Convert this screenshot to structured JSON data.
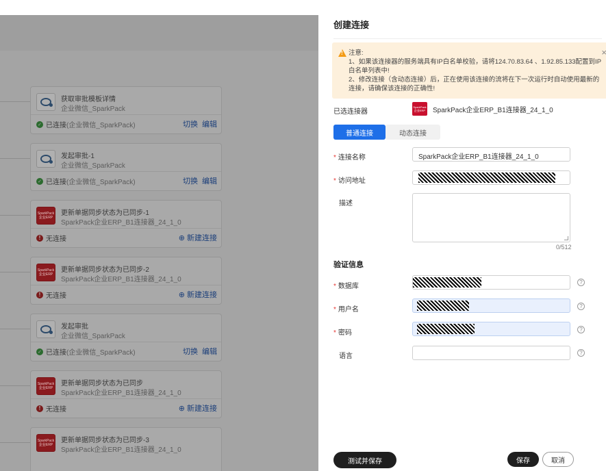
{
  "flow": {
    "cards": [
      {
        "title": "获取审批模板详情",
        "subtitle": "企业微信_SparkPack",
        "icon": "wecom-chat-icon",
        "status_text": "已连接",
        "status_detail": "(企业微信_SparkPack)",
        "connected": true,
        "action1": "切换",
        "action2": "编辑"
      },
      {
        "title": "发起审批-1",
        "subtitle": "企业微信_SparkPack",
        "icon": "wecom-chat-icon",
        "status_text": "已连接",
        "status_detail": "(企业微信_SparkPack)",
        "connected": true,
        "action1": "切换",
        "action2": "编辑"
      },
      {
        "title": "更新单据同步状态为已同步-1",
        "subtitle": "SparkPack企业ERP_B1连接器_24_1_0",
        "icon": "sparkpack-logo-icon",
        "status_text": "无连接",
        "connected": false,
        "action_new": "⊕ 新建连接"
      },
      {
        "title": "更新单据同步状态为已同步-2",
        "subtitle": "SparkPack企业ERP_B1连接器_24_1_0",
        "icon": "sparkpack-logo-icon",
        "status_text": "无连接",
        "connected": false,
        "action_new": "⊕ 新建连接"
      },
      {
        "title": "发起审批",
        "subtitle": "企业微信_SparkPack",
        "icon": "wecom-chat-icon",
        "status_text": "已连接",
        "status_detail": "(企业微信_SparkPack)",
        "connected": true,
        "action1": "切换",
        "action2": "编辑"
      },
      {
        "title": "更新单据同步状态为已同步",
        "subtitle": "SparkPack企业ERP_B1连接器_24_1_0",
        "icon": "sparkpack-logo-icon",
        "status_text": "无连接",
        "connected": false,
        "action_new": "⊕ 新建连接"
      },
      {
        "title": "更新单据同步状态为已同步-3",
        "subtitle": "SparkPack企业ERP_B1连接器_24_1_0",
        "icon": "sparkpack-logo-icon"
      }
    ],
    "logo_text_line1": "SparkPack",
    "logo_text_line2": "企业ERP"
  },
  "drawer": {
    "title": "创建连接",
    "notice": {
      "heading": "注意:",
      "line1": "1、如果该连接器的服务端具有IP白名单校验，请将124.70.83.64 、1.92.85.133配置到IP白名单列表中!",
      "line2": "2、修改连接（含动态连接）后，正在使用该连接的流将在下一次运行时自动使用最新的连接，请确保该连接的正确性!"
    },
    "selected_connector_label": "已选连接器",
    "selected_connector_value": "SparkPack企业ERP_B1连接器_24_1_0",
    "tabs": [
      "普通连接",
      "动态连接"
    ],
    "fields": {
      "name_label": "连接名称",
      "name_value": "SparkPack企业ERP_B1连接器_24_1_0",
      "url_label": "访问地址",
      "desc_label": "描述",
      "desc_counter": "0/512"
    },
    "auth_section_title": "验证信息",
    "auth": {
      "db_label": "数据库",
      "user_label": "用户名",
      "password_label": "密码",
      "lang_label": "语言"
    },
    "buttons": {
      "test_save": "测试并保存",
      "save": "保存",
      "cancel": "取消"
    }
  },
  "colors": {
    "primary": "#1e6fe8",
    "danger": "#e53935",
    "warning_bg": "#fdf0dc",
    "sparkpack_red": "#c8102e"
  }
}
